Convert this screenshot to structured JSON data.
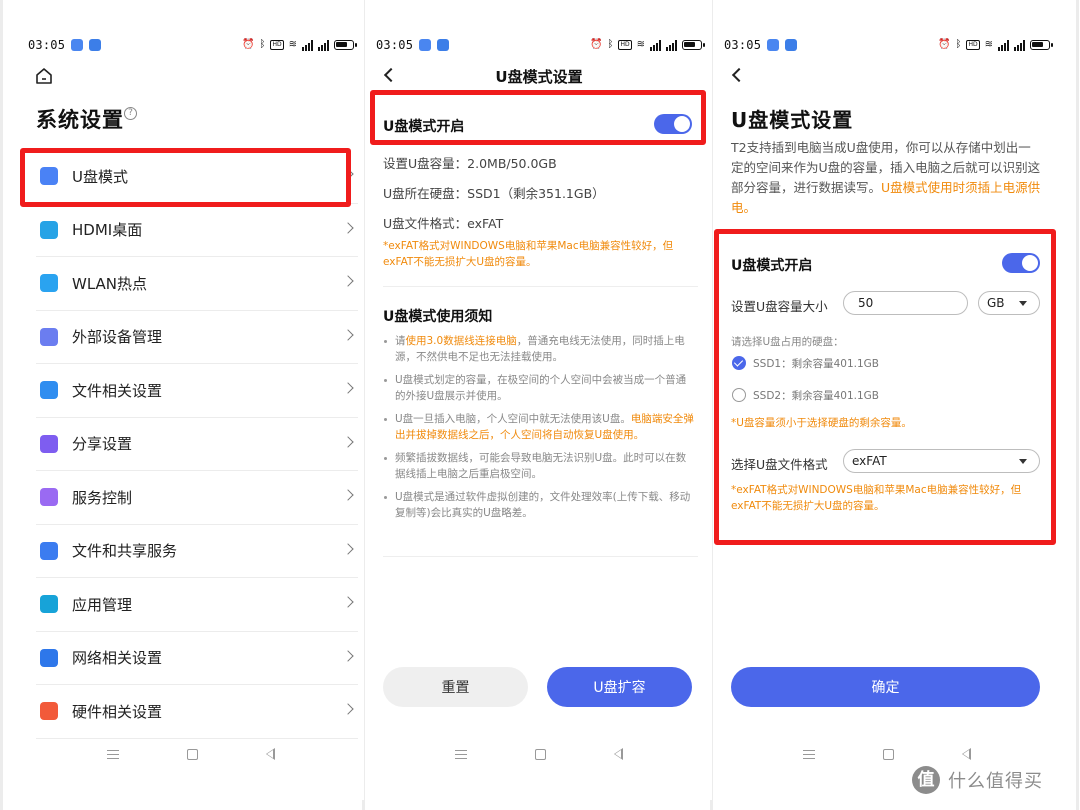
{
  "status_bar": {
    "time": "03:05"
  },
  "screen1": {
    "title": "系统设置",
    "help_icon": "question-circle-icon",
    "menu": [
      {
        "label": "U盘模式",
        "icon": "usb-drive-icon",
        "color": "#4a82f5"
      },
      {
        "label": "HDMI桌面",
        "icon": "monitor-icon",
        "color": "#27a3e6"
      },
      {
        "label": "WLAN热点",
        "icon": "hotspot-icon",
        "color": "#2aa3f0"
      },
      {
        "label": "外部设备管理",
        "icon": "devices-icon",
        "color": "#6b7df0"
      },
      {
        "label": "文件相关设置",
        "icon": "file-settings-icon",
        "color": "#2f8df0"
      },
      {
        "label": "分享设置",
        "icon": "share-icon",
        "color": "#7e5df0"
      },
      {
        "label": "服务控制",
        "icon": "toggle-service-icon",
        "color": "#9a6af2"
      },
      {
        "label": "文件和共享服务",
        "icon": "file-share-icon",
        "color": "#3b7cf0"
      },
      {
        "label": "应用管理",
        "icon": "app-manage-icon",
        "color": "#17a3d8"
      },
      {
        "label": "网络相关设置",
        "icon": "globe-icon",
        "color": "#2e77ea"
      },
      {
        "label": "硬件相关设置",
        "icon": "hardware-grid-icon",
        "color": "#f25a3a"
      }
    ]
  },
  "screen2": {
    "title": "U盘模式设置",
    "toggle_label": "U盘模式开启",
    "toggle_on": true,
    "info": {
      "capacity": "设置U盘容量：2.0MB/50.0GB",
      "disk": "U盘所在硬盘：SSD1（剩余351.1GB）",
      "format": "U盘文件格式：exFAT"
    },
    "format_note": "*exFAT格式对WINDOWS电脑和苹果Mac电脑兼容性较好，但exFAT不能无损扩大U盘的容量。",
    "notice_title": "U盘模式使用须知",
    "notices": [
      {
        "prefix": "请",
        "highlight": "使用3.0数据线连接电脑",
        "suffix": "，普通充电线无法使用，同时插上电源，不然供电不足也无法挂载使用。"
      },
      {
        "prefix": "U盘模式划定的容量，在极空间的个人空间中会被当成一个普通的外接U盘展示并使用。",
        "highlight": "",
        "suffix": ""
      },
      {
        "prefix": "U盘一旦插入电脑，个人空间中就无法使用该U盘。",
        "highlight": "电脑端安全弹出并拔掉数据线之后，个人空间将自动恢复U盘使用。",
        "suffix": ""
      },
      {
        "prefix": "频繁插拔数据线，可能会导致电脑无法识别U盘。此时可以在数据线插上电脑之后重启极空间。",
        "highlight": "",
        "suffix": ""
      },
      {
        "prefix": "U盘模式是通过软件虚拟创建的，文件处理效率(上传下载、移动复制等)会比真实的U盘略差。",
        "highlight": "",
        "suffix": ""
      }
    ],
    "reset_button": "重置",
    "expand_button": "U盘扩容"
  },
  "screen3": {
    "title": "U盘模式设置",
    "desc_prefix": "T2支持插到电脑当成U盘使用，你可以从存储中划出一定的空间来作为U盘的容量，插入电脑之后就可以识别这部分容量，进行数据读写。",
    "desc_highlight": "U盘模式使用时须插上电源供电。",
    "toggle_label": "U盘模式开启",
    "toggle_on": true,
    "size_label": "设置U盘容量大小",
    "size_value": "50",
    "unit_value": "GB",
    "disk_prompt": "请选择U盘占用的硬盘：",
    "disks": [
      {
        "label": "SSD1：剩余容量401.1GB",
        "selected": true
      },
      {
        "label": "SSD2：剩余容量401.1GB",
        "selected": false
      }
    ],
    "capacity_note": "*U盘容量须小于选择硬盘的剩余容量。",
    "format_label": "选择U盘文件格式",
    "format_value": "exFAT",
    "format_note": "*exFAT格式对WINDOWS电脑和苹果Mac电脑兼容性较好，但exFAT不能无损扩大U盘的容量。",
    "confirm_button": "确定"
  },
  "watermark": {
    "icon_text": "值",
    "text": "什么值得买"
  }
}
